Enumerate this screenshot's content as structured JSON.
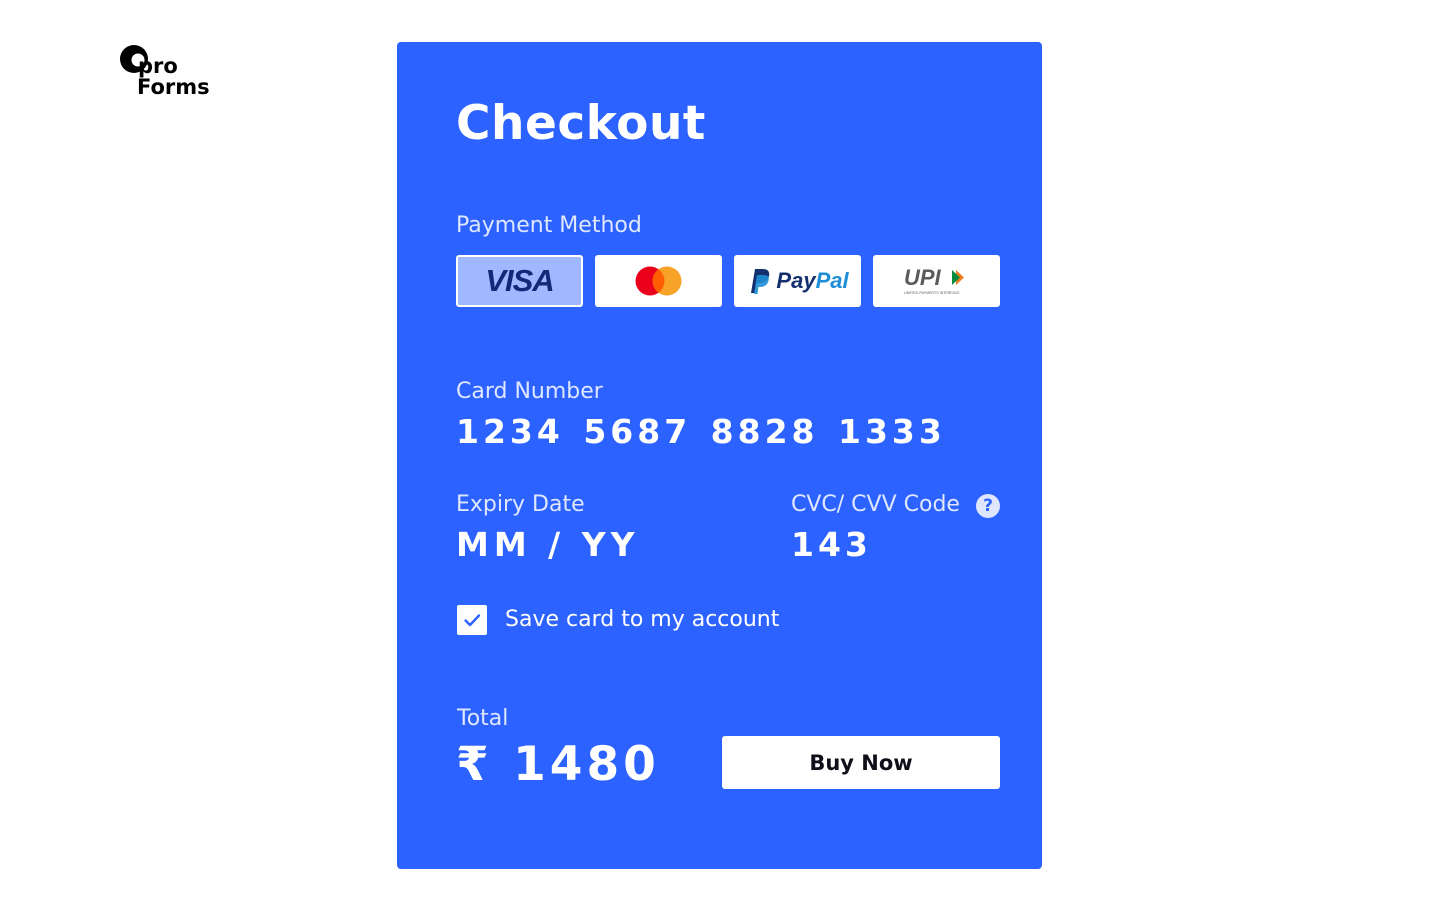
{
  "brand": {
    "logo_line1": "pro",
    "logo_line2": "Forms"
  },
  "checkout": {
    "title": "Checkout",
    "payment_method_label": "Payment Method",
    "payment_methods": [
      {
        "name": "VISA",
        "selected": true
      },
      {
        "name": "Mastercard",
        "selected": false
      },
      {
        "name": "PayPal",
        "selected": false
      },
      {
        "name": "UPI",
        "selected": false
      }
    ],
    "visa_text": "VISA",
    "paypal_pay": "Pay",
    "paypal_pal": "Pal",
    "upi_text": "UPI",
    "upi_subtext": "UNIFIED PAYMENTS INTERFACE",
    "card_number_label": "Card Number",
    "card_number_value": "1234 5687 8828 1333",
    "expiry_label": "Expiry Date",
    "expiry_value": "MM / YY",
    "cvc_label": "CVC/ CVV Code",
    "cvc_help": "?",
    "cvc_value": "143",
    "save_card_label": "Save card to my account",
    "save_card_checked": true,
    "total_label": "Total",
    "total_value": "₹ 1480",
    "buy_button": "Buy Now"
  },
  "colors": {
    "card_background": "#2c62ff",
    "selected_method": "#9fb8ff",
    "mastercard_red": "#eb001b",
    "mastercard_orange": "#f79e1b",
    "visa_navy": "#14287a",
    "paypal_dark": "#14306e",
    "paypal_light": "#1e8fd6"
  }
}
